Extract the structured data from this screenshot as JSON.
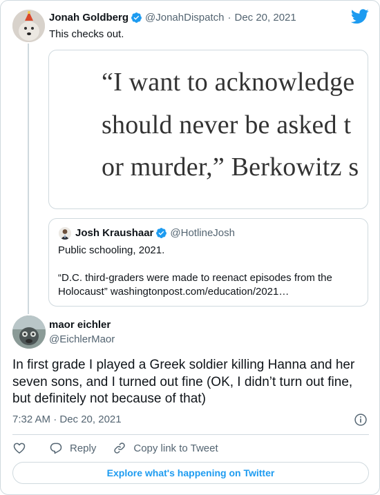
{
  "parent_tweet": {
    "author_name": "Jonah Goldberg",
    "handle": "@JonahDispatch",
    "separator": "·",
    "date": "Dec 20, 2021",
    "text": "This checks out.",
    "media_lines": [
      "“I want to acknowledge",
      "should never be asked t",
      "or murder,” Berkowitz s"
    ]
  },
  "quoted_tweet": {
    "author_name": "Josh Kraushaar",
    "handle": "@HotlineJosh",
    "line1": "Public schooling, 2021.",
    "line2": "“D.C. third-graders were made to reenact episodes from the Holocaust” washingtonpost.com/education/2021…"
  },
  "main_tweet": {
    "author_name": "maor eichler",
    "handle": "@EichlerMaor",
    "text": "In first grade I played a Greek soldier killing Hanna and her seven sons, and I turned out fine (OK, I didn’t turn out fine, but definitely not because of that)",
    "timestamp": "7:32 AM · Dec 20, 2021"
  },
  "actions": {
    "reply_label": "Reply",
    "copy_label": "Copy link to Tweet"
  },
  "explore_label": "Explore what's happening on Twitter",
  "colors": {
    "twitter_blue": "#1d9bf0",
    "text": "#0f1419",
    "muted": "#536471",
    "border": "#cfd9de"
  },
  "icons": [
    "twitter-bird-icon",
    "verified-badge-icon",
    "info-icon",
    "heart-icon",
    "reply-icon",
    "link-icon"
  ]
}
